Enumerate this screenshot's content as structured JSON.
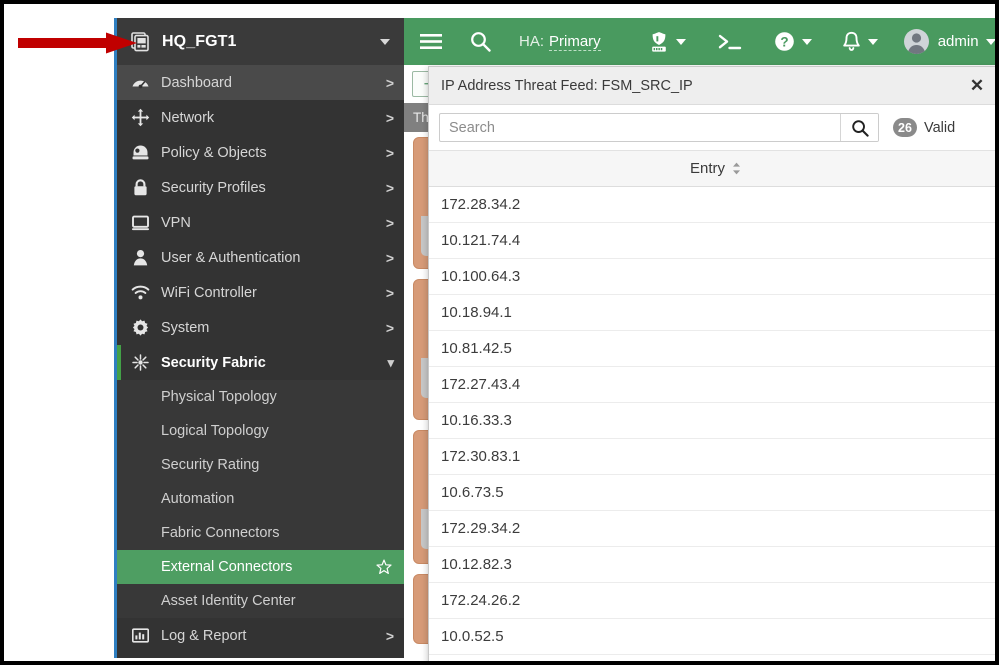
{
  "sidebar": {
    "device": {
      "name": "HQ_FGT1",
      "icon": "device-stack-icon",
      "caret": "chevron-down-icon"
    },
    "items": [
      {
        "label": "Dashboard",
        "icon": "dashboard-gauge-icon",
        "chevron": ">",
        "state": "hovered"
      },
      {
        "label": "Network",
        "icon": "network-arrows-icon",
        "chevron": ">",
        "state": "normal"
      },
      {
        "label": "Policy & Objects",
        "icon": "policy-shield-icon",
        "chevron": ">",
        "state": "normal"
      },
      {
        "label": "Security Profiles",
        "icon": "lock-icon",
        "chevron": ">",
        "state": "normal"
      },
      {
        "label": "VPN",
        "icon": "monitor-icon",
        "chevron": ">",
        "state": "normal"
      },
      {
        "label": "User & Authentication",
        "icon": "user-icon",
        "chevron": ">",
        "state": "normal"
      },
      {
        "label": "WiFi Controller",
        "icon": "wifi-icon",
        "chevron": ">",
        "state": "normal"
      },
      {
        "label": "System",
        "icon": "gear-icon",
        "chevron": ">",
        "state": "normal"
      },
      {
        "label": "Security Fabric",
        "icon": "security-fabric-icon",
        "chevron": "v",
        "state": "expanded"
      }
    ],
    "subitems": [
      {
        "label": "Physical Topology",
        "selected": false,
        "star": false
      },
      {
        "label": "Logical Topology",
        "selected": false,
        "star": false
      },
      {
        "label": "Security Rating",
        "selected": false,
        "star": false
      },
      {
        "label": "Automation",
        "selected": false,
        "star": false
      },
      {
        "label": "Fabric Connectors",
        "selected": false,
        "star": false
      },
      {
        "label": "External Connectors",
        "selected": true,
        "star": true
      },
      {
        "label": "Asset Identity Center",
        "selected": false,
        "star": false
      }
    ],
    "footer_item": {
      "label": "Log & Report",
      "icon": "log-report-chart-icon",
      "chevron": ">"
    }
  },
  "topbar": {
    "menu_icon": "hamburger-menu-icon",
    "search_icon": "search-icon",
    "ha_label": "HA:",
    "ha_value": "Primary",
    "fortiguard_icon": "fortiguard-gauge-icon",
    "cli_icon": "cli-console-icon",
    "help_icon": "help-question-icon",
    "alert_icon": "notification-bell-icon",
    "avatar_icon": "user-avatar-icon",
    "username": "admin",
    "accent_color": "#499a5f"
  },
  "background_page": {
    "create_new_label": "+",
    "column_header_truncated": "Th"
  },
  "modal": {
    "title": "IP Address Threat Feed: FSM_SRC_IP",
    "close_icon": "close-icon",
    "search": {
      "value": "",
      "placeholder": "Search",
      "button_icon": "search-icon"
    },
    "valid_count": "26",
    "valid_label": "Valid",
    "table": {
      "column_header": "Entry",
      "sort_icon": "sort-arrows-icon",
      "rows": [
        "172.28.34.2",
        "10.121.74.4",
        "10.100.64.3",
        "10.18.94.1",
        "10.81.42.5",
        "172.27.43.4",
        "10.16.33.3",
        "172.30.83.1",
        "10.6.73.5",
        "172.29.34.2",
        "10.12.82.3",
        "172.24.26.2",
        "10.0.52.5"
      ]
    }
  },
  "annotation": {
    "arrow_color": "#c00000",
    "points_to": "device-selector"
  }
}
